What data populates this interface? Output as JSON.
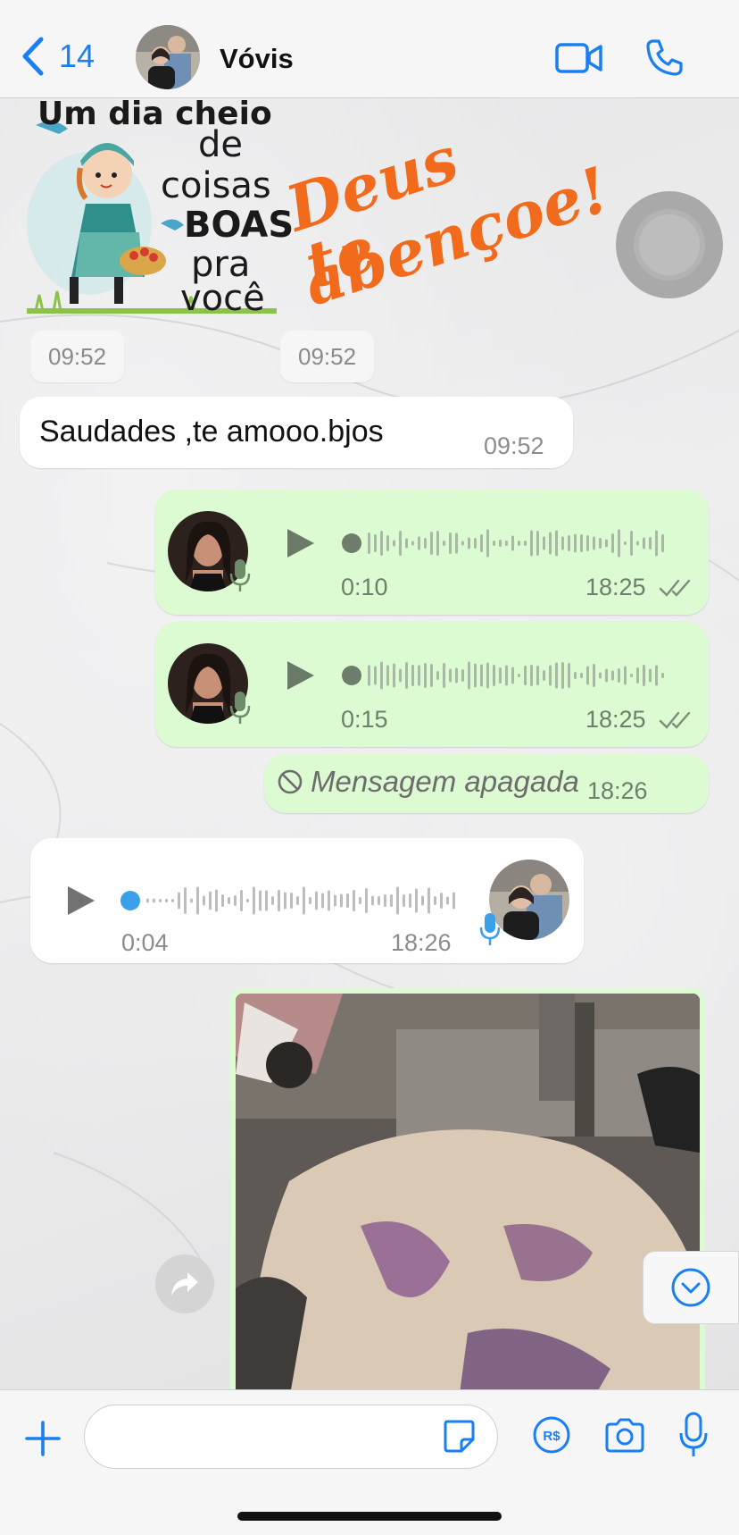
{
  "header": {
    "back_count": "14",
    "contact_name": "Vóvis",
    "back_icon": "chevron-left-icon",
    "video_icon": "video-camera-icon",
    "call_icon": "phone-icon"
  },
  "stickers": {
    "left_lines": [
      "Um dia cheio",
      "de",
      "coisas",
      "BOAS",
      "pra",
      "você"
    ],
    "right_lines": [
      "Deus te",
      "abençoe!"
    ],
    "left_time": "09:52",
    "right_time": "09:52"
  },
  "messages": [
    {
      "type": "text",
      "direction": "in",
      "text": "Saudades ,te amooo.bjos",
      "time": "09:52"
    },
    {
      "type": "voice",
      "direction": "out",
      "duration": "0:10",
      "time": "18:25",
      "status": "read"
    },
    {
      "type": "voice",
      "direction": "out",
      "duration": "0:15",
      "time": "18:25",
      "status": "read"
    },
    {
      "type": "deleted",
      "direction": "out",
      "text": "Mensagem apagada",
      "time": "18:26"
    },
    {
      "type": "voice",
      "direction": "in",
      "duration": "0:04",
      "time": "18:26"
    },
    {
      "type": "image",
      "direction": "out"
    }
  ],
  "input_bar": {
    "placeholder": "",
    "icons": [
      "plus-icon",
      "sticker-icon",
      "pix-payment-icon",
      "camera-icon",
      "microphone-icon"
    ]
  },
  "colors": {
    "accent": "#1a7ff0",
    "outgoing_bubble": "#dcfbd3",
    "incoming_bubble": "#ffffff",
    "sticker_orange": "#f26a1b"
  }
}
